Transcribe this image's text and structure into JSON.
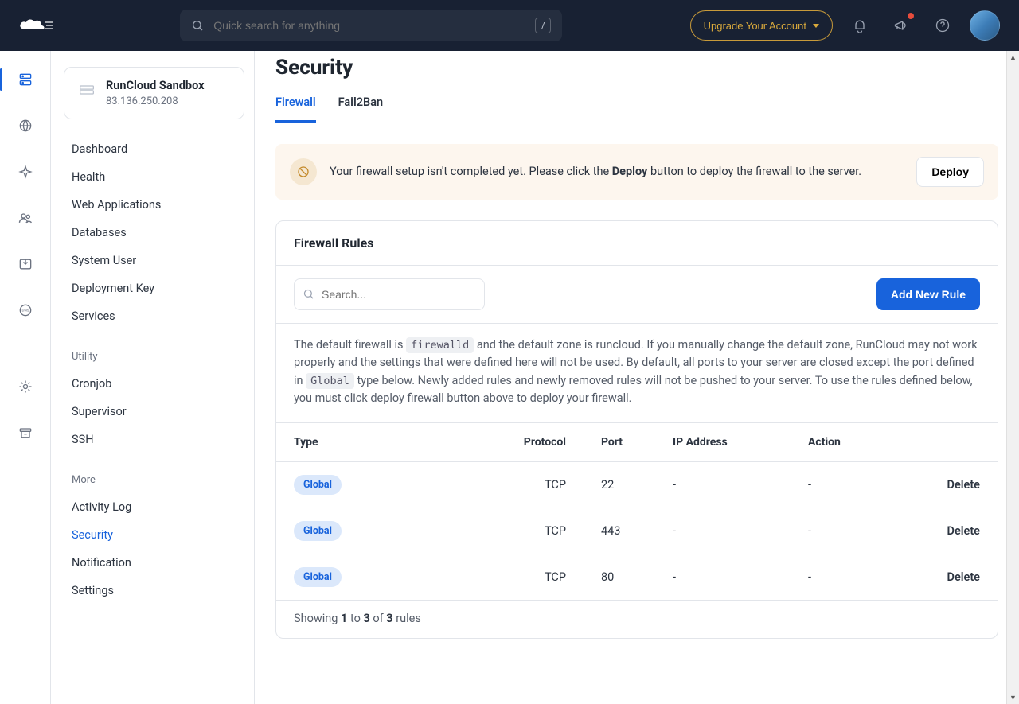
{
  "header": {
    "search_placeholder": "Quick search for anything",
    "slash_key": "/",
    "upgrade_label": "Upgrade Your Account"
  },
  "rail": {
    "items": [
      {
        "name": "servers",
        "active": true
      },
      {
        "name": "globe"
      },
      {
        "name": "star"
      },
      {
        "name": "team"
      },
      {
        "name": "inbox"
      },
      {
        "name": "dns"
      }
    ],
    "bottom": [
      {
        "name": "settings"
      },
      {
        "name": "archive"
      }
    ]
  },
  "server_card": {
    "name": "RunCloud Sandbox",
    "ip": "83.136.250.208"
  },
  "sidenav": {
    "groups": [
      {
        "label": null,
        "items": [
          {
            "label": "Dashboard"
          },
          {
            "label": "Health"
          },
          {
            "label": "Web Applications"
          },
          {
            "label": "Databases"
          },
          {
            "label": "System User"
          },
          {
            "label": "Deployment Key"
          },
          {
            "label": "Services"
          }
        ]
      },
      {
        "label": "Utility",
        "items": [
          {
            "label": "Cronjob"
          },
          {
            "label": "Supervisor"
          },
          {
            "label": "SSH"
          }
        ]
      },
      {
        "label": "More",
        "items": [
          {
            "label": "Activity Log"
          },
          {
            "label": "Security",
            "active": true
          },
          {
            "label": "Notification"
          },
          {
            "label": "Settings"
          }
        ]
      }
    ]
  },
  "page": {
    "title": "Security",
    "tabs": [
      {
        "label": "Firewall",
        "active": true
      },
      {
        "label": "Fail2Ban"
      }
    ],
    "alert": {
      "text_prefix": "Your firewall setup isn't completed yet. Please click the ",
      "text_bold": "Deploy",
      "text_suffix": " button to deploy the firewall to the server.",
      "button": "Deploy"
    },
    "panel": {
      "title": "Firewall Rules",
      "search_placeholder": "Search...",
      "add_button": "Add New Rule",
      "info_prefix": "The default firewall is ",
      "info_code1": "firewalld",
      "info_mid1": " and the default zone is runcloud. If you manually change the default zone, RunCloud may not work properly and the settings that were defined here will not be used. By default, all ports to your server are closed except the port defined in ",
      "info_code2": "Global",
      "info_suffix": " type below. Newly added rules and newly removed rules will not be pushed to your server. To use the rules defined below, you must click deploy firewall button above to deploy your firewall.",
      "columns": {
        "type": "Type",
        "protocol": "Protocol",
        "port": "Port",
        "ip": "IP Address",
        "action": "Action"
      },
      "rows": [
        {
          "type": "Global",
          "protocol": "TCP",
          "port": "22",
          "ip": "-",
          "action": "-",
          "delete": "Delete"
        },
        {
          "type": "Global",
          "protocol": "TCP",
          "port": "443",
          "ip": "-",
          "action": "-",
          "delete": "Delete"
        },
        {
          "type": "Global",
          "protocol": "TCP",
          "port": "80",
          "ip": "-",
          "action": "-",
          "delete": "Delete"
        }
      ],
      "footer": {
        "word_showing": "Showing ",
        "from": "1",
        "word_to": " to ",
        "to": "3",
        "word_of": " of ",
        "total": "3",
        "word_rules": " rules"
      }
    }
  }
}
